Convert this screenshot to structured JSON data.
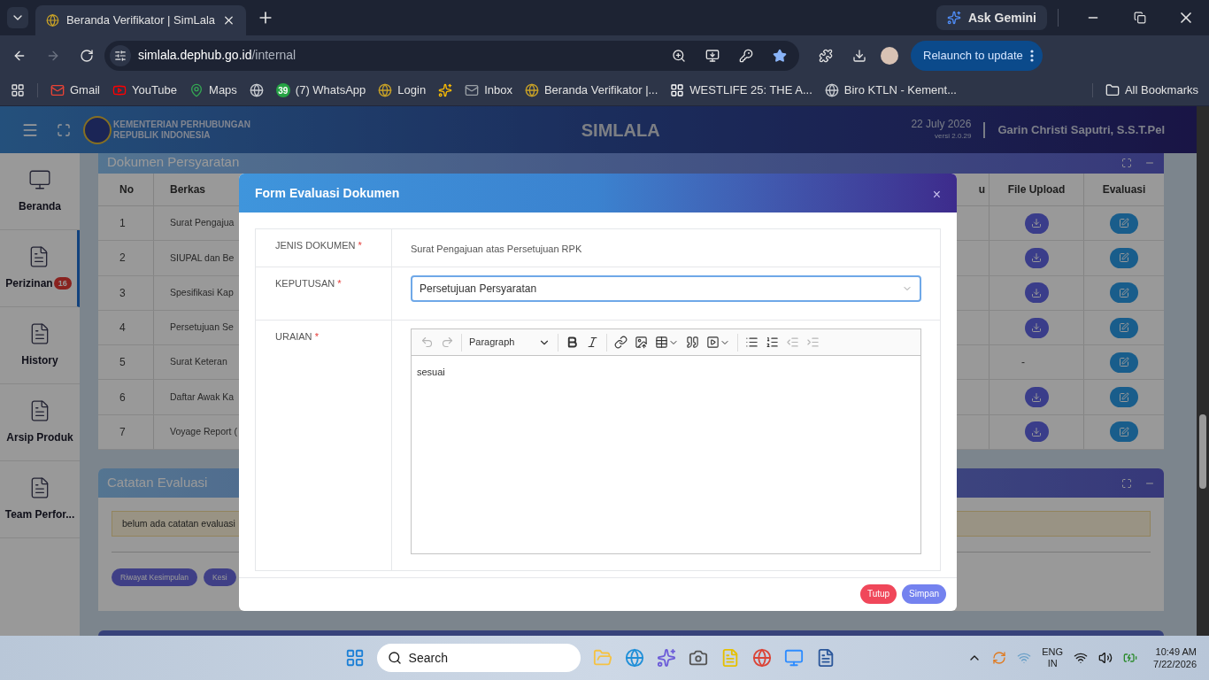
{
  "browser": {
    "tab": {
      "title": "Beranda Verifikator | SimLala"
    },
    "address": {
      "domain": "simlala.dephub.go.id",
      "path": "/internal"
    },
    "ask_gemini": "Ask Gemini",
    "relaunch": "Relaunch to update",
    "bookmarks": [
      {
        "kind": "link",
        "label": "Gmail"
      },
      {
        "kind": "link",
        "label": "YouTube"
      },
      {
        "kind": "link",
        "label": "Maps"
      },
      {
        "kind": "icon"
      },
      {
        "kind": "link",
        "label": "(7) WhatsApp",
        "badge": "39"
      },
      {
        "kind": "link",
        "label": "Login"
      },
      {
        "kind": "icon"
      },
      {
        "kind": "link",
        "label": "Inbox"
      },
      {
        "kind": "link",
        "label": "Beranda Verifikator |..."
      },
      {
        "kind": "link",
        "label": "WESTLIFE 25: THE A..."
      },
      {
        "kind": "link",
        "label": "Biro KTLN - Kement..."
      }
    ],
    "all_bookmarks": "All Bookmarks"
  },
  "header": {
    "org_line1": "KEMENTERIAN PERHUBUNGAN",
    "org_line2": "REPUBLIK INDONESIA",
    "app_title": "SIMLALA",
    "date": "22 July 2026",
    "version": "versi 2.0.29",
    "user": "Garin Christi Saputri, S.S.T.Pel"
  },
  "sidebar": {
    "items": [
      {
        "label": "Beranda",
        "selected": false
      },
      {
        "label": "Perizinan",
        "badge": "16",
        "selected": true
      },
      {
        "label": "History",
        "selected": false
      },
      {
        "label": "Arsip Produk",
        "selected": false
      },
      {
        "label": "Team Perfor...",
        "selected": false
      }
    ]
  },
  "documents_panel": {
    "title": "Dokumen Persyaratan",
    "columns": [
      "No",
      "Berkas",
      "u",
      "File Upload",
      "Evaluasi"
    ],
    "rows": [
      {
        "no": "1",
        "berkas": "Surat Pengajua",
        "has_file": true
      },
      {
        "no": "2",
        "berkas": "SIUPAL dan Be",
        "has_file": true
      },
      {
        "no": "3",
        "berkas": "Spesifikasi Kap",
        "has_file": true
      },
      {
        "no": "4",
        "berkas": "Persetujuan Se",
        "has_file": true
      },
      {
        "no": "5",
        "berkas": "Surat Keteran",
        "has_file": false,
        "file_note": "-"
      },
      {
        "no": "6",
        "berkas": "Daftar Awak Ka",
        "has_file": true
      },
      {
        "no": "7",
        "berkas": "Voyage Report (",
        "has_file": true
      }
    ]
  },
  "notes_panel": {
    "title": "Catatan Evaluasi",
    "note": "belum ada catatan evaluasi",
    "buttons": [
      "Riwayat Kesimpulan",
      "Kesi"
    ]
  },
  "modal": {
    "title": "Form Evaluasi Dokumen",
    "close": "×",
    "fields": [
      {
        "kind": "text",
        "label": "JENIS DOKUMEN",
        "required_mark": "*",
        "value": "Surat Pengajuan atas Persetujuan RPK"
      },
      {
        "kind": "select",
        "label": "KEPUTUSAN",
        "required_mark": "*",
        "value": "Persetujuan Persyaratan"
      },
      {
        "kind": "editor",
        "label": "URAIAN",
        "required_mark": "*",
        "value": "sesuai"
      }
    ],
    "editor": {
      "heading_select": "Paragraph",
      "tools": [
        {
          "disabled": true
        },
        {
          "disabled": true
        },
        {
          "disabled": false
        },
        {
          "disabled": false
        },
        {
          "disabled": false
        },
        {
          "disabled": false
        },
        {
          "disabled": false
        },
        {
          "disabled": false
        },
        {
          "disabled": false
        },
        {
          "disabled": false
        },
        {
          "disabled": false
        },
        {
          "disabled": true
        },
        {
          "disabled": true
        }
      ]
    },
    "buttons": [
      {
        "label": "Tutup",
        "kind": "danger"
      },
      {
        "label": "Simpan",
        "kind": "primary"
      }
    ]
  },
  "taskbar": {
    "search": "Search",
    "lang": "ENG",
    "region": "IN",
    "time": "10:49 AM",
    "date": "7/22/2026"
  }
}
